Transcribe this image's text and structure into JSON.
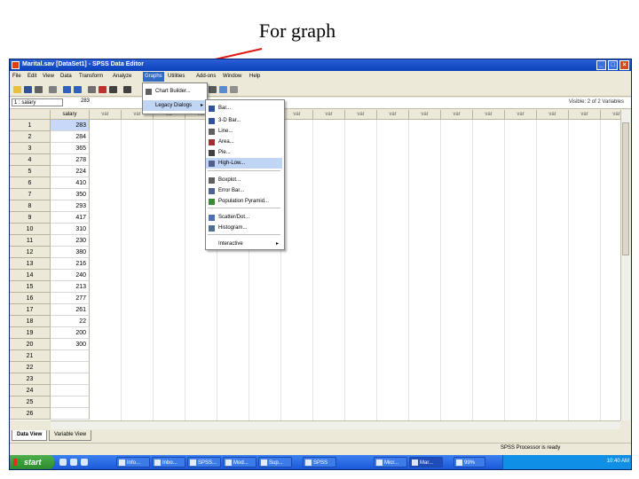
{
  "slide": {
    "annotation": "For graph"
  },
  "window": {
    "title": "Marital.sav [DataSet1] - SPSS Data Editor"
  },
  "menus": [
    "File",
    "Edit",
    "View",
    "Data",
    "Transform",
    "Analyze",
    "Graphs",
    "Utilities",
    "Add-ons",
    "Window",
    "Help"
  ],
  "cell_editor": {
    "ref": "1 : salary",
    "value": "283",
    "visible": "Visible: 2 of 2 Variables"
  },
  "grid": {
    "first_column": "salary",
    "var_label": "var",
    "rows": [
      "1",
      "2",
      "3",
      "4",
      "5",
      "6",
      "7",
      "8",
      "9",
      "10",
      "11",
      "12",
      "13",
      "14",
      "15",
      "16",
      "17",
      "18",
      "19",
      "20",
      "21",
      "22",
      "23",
      "24",
      "25",
      "26"
    ],
    "values": [
      "283",
      "284",
      "365",
      "278",
      "224",
      "410",
      "350",
      "293",
      "417",
      "310",
      "230",
      "380",
      "216",
      "240",
      "213",
      "277",
      "261",
      "22",
      "200",
      "300",
      "",
      "",
      "",
      "",
      "",
      ""
    ]
  },
  "graphs_menu": {
    "items": [
      "Chart Builder...",
      "Legacy Dialogs"
    ],
    "highlighted": 1
  },
  "legacy_submenu": {
    "items": [
      "Bar...",
      "3-D Bar...",
      "Line...",
      "Area...",
      "Pie...",
      "High-Low...",
      "Boxplot...",
      "Error Bar...",
      "Population Pyramid...",
      "Scatter/Dot...",
      "Histogram...",
      "Interactive"
    ],
    "highlighted": 5
  },
  "tabs": {
    "data_view": "Data View",
    "variable_view": "Variable View"
  },
  "status": {
    "text": "SPSS Processor is ready"
  },
  "taskbar": {
    "start": "start",
    "tasks": [
      "Info...",
      "Inbo...",
      "SPSS...",
      "Mod...",
      "Sup...",
      "SPSS",
      "Micr...",
      "Mar...",
      "99%"
    ],
    "clock": "10:40 AM"
  },
  "colors": {
    "title_bar": "#0a40b8",
    "selection": "#316ac5",
    "start_button": "#2e8a2e",
    "arrow": "#e01818"
  }
}
